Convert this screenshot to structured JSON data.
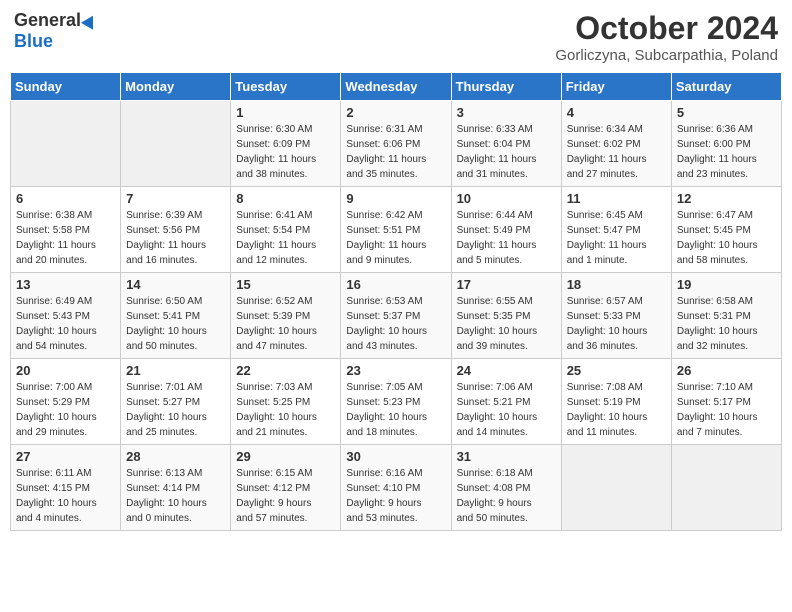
{
  "header": {
    "logo_general": "General",
    "logo_blue": "Blue",
    "title": "October 2024",
    "subtitle": "Gorliczyna, Subcarpathia, Poland"
  },
  "days_of_week": [
    "Sunday",
    "Monday",
    "Tuesday",
    "Wednesday",
    "Thursday",
    "Friday",
    "Saturday"
  ],
  "weeks": [
    [
      {
        "day": "",
        "info": ""
      },
      {
        "day": "",
        "info": ""
      },
      {
        "day": "1",
        "info": "Sunrise: 6:30 AM\nSunset: 6:09 PM\nDaylight: 11 hours\nand 38 minutes."
      },
      {
        "day": "2",
        "info": "Sunrise: 6:31 AM\nSunset: 6:06 PM\nDaylight: 11 hours\nand 35 minutes."
      },
      {
        "day": "3",
        "info": "Sunrise: 6:33 AM\nSunset: 6:04 PM\nDaylight: 11 hours\nand 31 minutes."
      },
      {
        "day": "4",
        "info": "Sunrise: 6:34 AM\nSunset: 6:02 PM\nDaylight: 11 hours\nand 27 minutes."
      },
      {
        "day": "5",
        "info": "Sunrise: 6:36 AM\nSunset: 6:00 PM\nDaylight: 11 hours\nand 23 minutes."
      }
    ],
    [
      {
        "day": "6",
        "info": "Sunrise: 6:38 AM\nSunset: 5:58 PM\nDaylight: 11 hours\nand 20 minutes."
      },
      {
        "day": "7",
        "info": "Sunrise: 6:39 AM\nSunset: 5:56 PM\nDaylight: 11 hours\nand 16 minutes."
      },
      {
        "day": "8",
        "info": "Sunrise: 6:41 AM\nSunset: 5:54 PM\nDaylight: 11 hours\nand 12 minutes."
      },
      {
        "day": "9",
        "info": "Sunrise: 6:42 AM\nSunset: 5:51 PM\nDaylight: 11 hours\nand 9 minutes."
      },
      {
        "day": "10",
        "info": "Sunrise: 6:44 AM\nSunset: 5:49 PM\nDaylight: 11 hours\nand 5 minutes."
      },
      {
        "day": "11",
        "info": "Sunrise: 6:45 AM\nSunset: 5:47 PM\nDaylight: 11 hours\nand 1 minute."
      },
      {
        "day": "12",
        "info": "Sunrise: 6:47 AM\nSunset: 5:45 PM\nDaylight: 10 hours\nand 58 minutes."
      }
    ],
    [
      {
        "day": "13",
        "info": "Sunrise: 6:49 AM\nSunset: 5:43 PM\nDaylight: 10 hours\nand 54 minutes."
      },
      {
        "day": "14",
        "info": "Sunrise: 6:50 AM\nSunset: 5:41 PM\nDaylight: 10 hours\nand 50 minutes."
      },
      {
        "day": "15",
        "info": "Sunrise: 6:52 AM\nSunset: 5:39 PM\nDaylight: 10 hours\nand 47 minutes."
      },
      {
        "day": "16",
        "info": "Sunrise: 6:53 AM\nSunset: 5:37 PM\nDaylight: 10 hours\nand 43 minutes."
      },
      {
        "day": "17",
        "info": "Sunrise: 6:55 AM\nSunset: 5:35 PM\nDaylight: 10 hours\nand 39 minutes."
      },
      {
        "day": "18",
        "info": "Sunrise: 6:57 AM\nSunset: 5:33 PM\nDaylight: 10 hours\nand 36 minutes."
      },
      {
        "day": "19",
        "info": "Sunrise: 6:58 AM\nSunset: 5:31 PM\nDaylight: 10 hours\nand 32 minutes."
      }
    ],
    [
      {
        "day": "20",
        "info": "Sunrise: 7:00 AM\nSunset: 5:29 PM\nDaylight: 10 hours\nand 29 minutes."
      },
      {
        "day": "21",
        "info": "Sunrise: 7:01 AM\nSunset: 5:27 PM\nDaylight: 10 hours\nand 25 minutes."
      },
      {
        "day": "22",
        "info": "Sunrise: 7:03 AM\nSunset: 5:25 PM\nDaylight: 10 hours\nand 21 minutes."
      },
      {
        "day": "23",
        "info": "Sunrise: 7:05 AM\nSunset: 5:23 PM\nDaylight: 10 hours\nand 18 minutes."
      },
      {
        "day": "24",
        "info": "Sunrise: 7:06 AM\nSunset: 5:21 PM\nDaylight: 10 hours\nand 14 minutes."
      },
      {
        "day": "25",
        "info": "Sunrise: 7:08 AM\nSunset: 5:19 PM\nDaylight: 10 hours\nand 11 minutes."
      },
      {
        "day": "26",
        "info": "Sunrise: 7:10 AM\nSunset: 5:17 PM\nDaylight: 10 hours\nand 7 minutes."
      }
    ],
    [
      {
        "day": "27",
        "info": "Sunrise: 6:11 AM\nSunset: 4:15 PM\nDaylight: 10 hours\nand 4 minutes."
      },
      {
        "day": "28",
        "info": "Sunrise: 6:13 AM\nSunset: 4:14 PM\nDaylight: 10 hours\nand 0 minutes."
      },
      {
        "day": "29",
        "info": "Sunrise: 6:15 AM\nSunset: 4:12 PM\nDaylight: 9 hours\nand 57 minutes."
      },
      {
        "day": "30",
        "info": "Sunrise: 6:16 AM\nSunset: 4:10 PM\nDaylight: 9 hours\nand 53 minutes."
      },
      {
        "day": "31",
        "info": "Sunrise: 6:18 AM\nSunset: 4:08 PM\nDaylight: 9 hours\nand 50 minutes."
      },
      {
        "day": "",
        "info": ""
      },
      {
        "day": "",
        "info": ""
      }
    ]
  ]
}
